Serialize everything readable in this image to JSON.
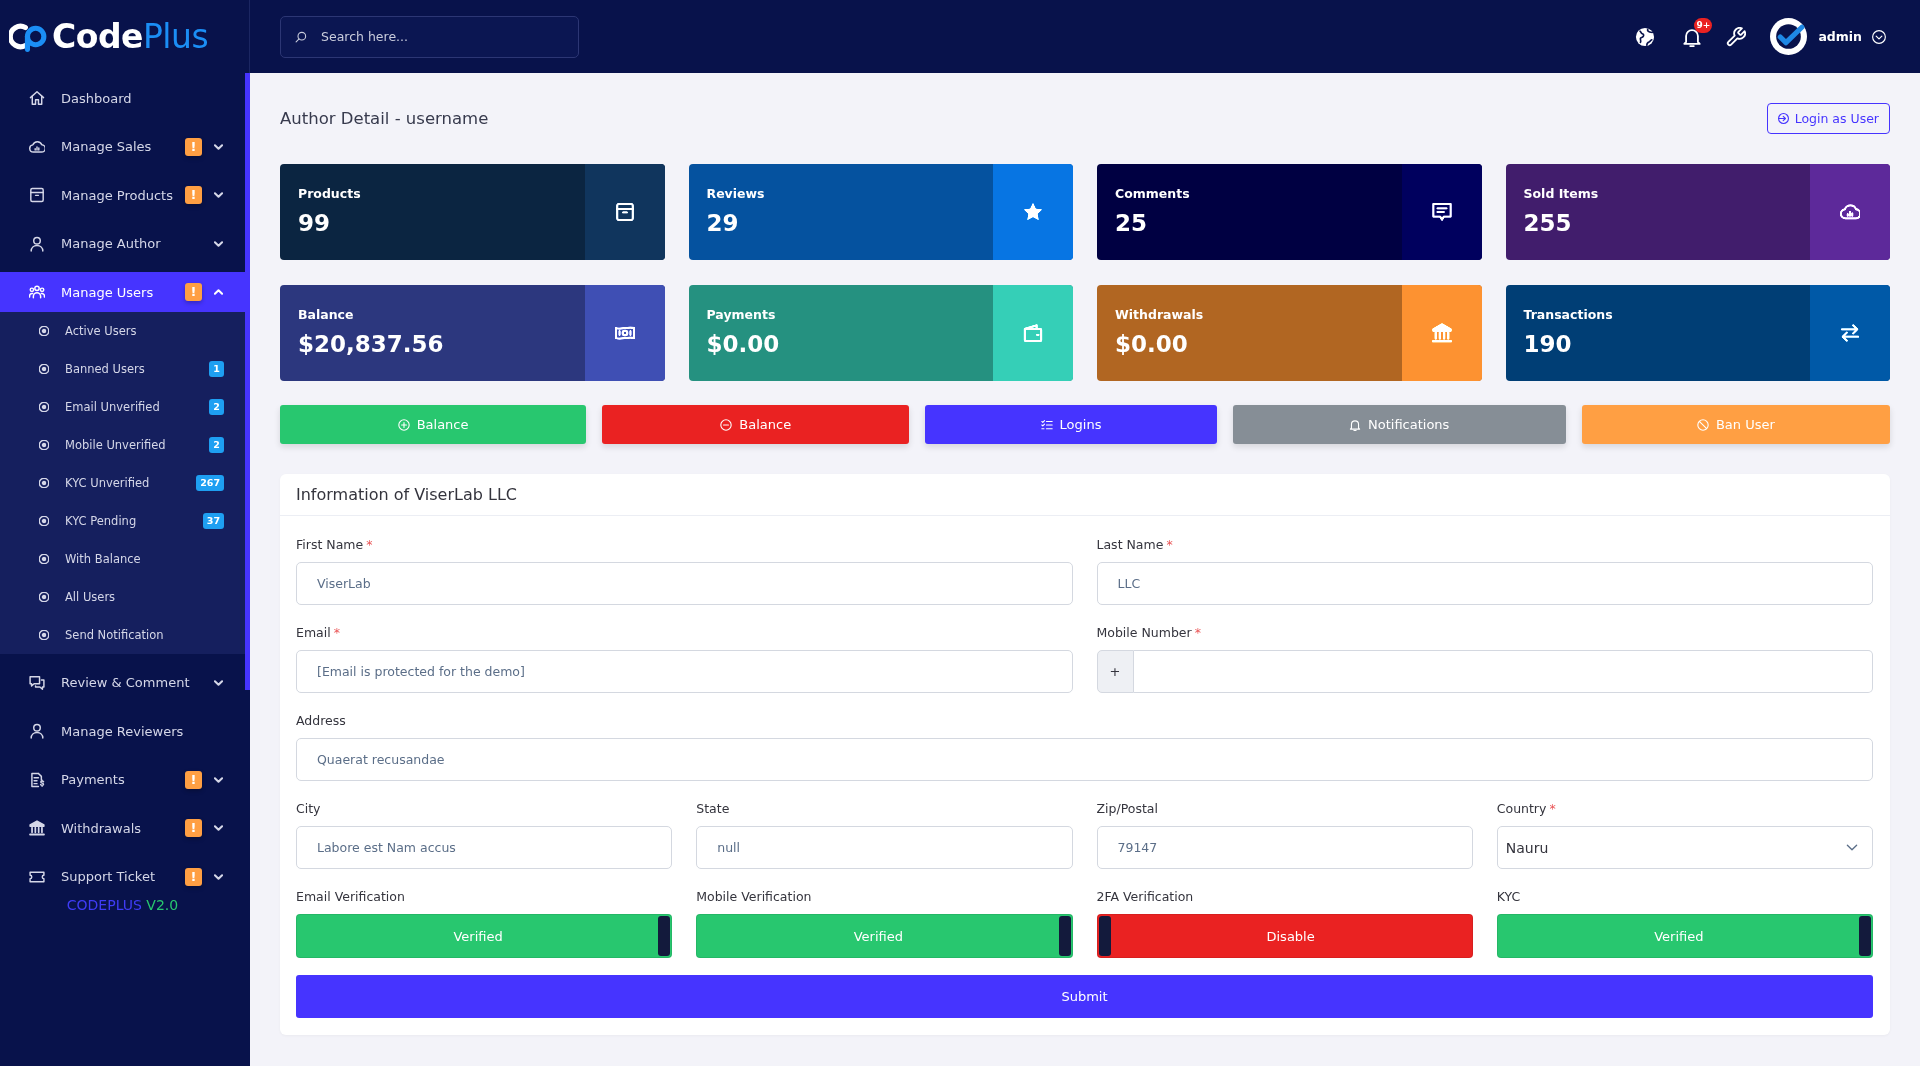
{
  "sidebar": {
    "logo": {
      "text": "Code",
      "accent": "Plus"
    },
    "items": [
      {
        "label": "Dashboard",
        "selected": false
      },
      {
        "label": "Manage Sales",
        "badge": "!",
        "expanded": false,
        "selected": false
      },
      {
        "label": "Manage Products",
        "badge": "!",
        "expanded": false,
        "selected": false
      },
      {
        "label": "Manage Author",
        "expanded": false,
        "selected": false
      },
      {
        "label": "Manage Users",
        "badge": "!",
        "expanded": true,
        "selected": true,
        "children": [
          {
            "label": "Active Users",
            "selected": false
          },
          {
            "label": "Banned Users",
            "badge": "1",
            "selected": false
          },
          {
            "label": "Email Unverified",
            "badge": "2",
            "selected": false
          },
          {
            "label": "Mobile Unverified",
            "badge": "2",
            "selected": false
          },
          {
            "label": "KYC Unverified",
            "badge": "267",
            "selected": false
          },
          {
            "label": "KYC Pending",
            "badge": "37",
            "selected": false
          },
          {
            "label": "With Balance",
            "selected": false
          },
          {
            "label": "All Users",
            "selected": false
          },
          {
            "label": "Send Notification",
            "selected": false
          }
        ]
      },
      {
        "label": "Review & Comment",
        "expanded": false,
        "selected": false
      },
      {
        "label": "Manage Reviewers",
        "selected": false
      },
      {
        "label": "Payments",
        "badge": "!",
        "expanded": false,
        "selected": false
      },
      {
        "label": "Withdrawals",
        "badge": "!",
        "expanded": false,
        "selected": false
      },
      {
        "label": "Support Ticket",
        "badge": "!",
        "expanded": false,
        "selected": false
      }
    ],
    "version": {
      "product": "CODEPLUS",
      "number": "V2.0"
    }
  },
  "topbar": {
    "search": {
      "placeholder": "Search here..."
    },
    "notifications": {
      "count": "9+"
    },
    "user": {
      "name": "admin"
    }
  },
  "page": {
    "title": "Author Detail - username",
    "login_button": "Login as User"
  },
  "stats": [
    {
      "label": "Products",
      "value": "99",
      "color": "#0b2541"
    },
    {
      "label": "Reviews",
      "value": "29",
      "color": "#05529f"
    },
    {
      "label": "Comments",
      "value": "25",
      "color": "#000042"
    },
    {
      "label": "Sold Items",
      "value": "255",
      "color": "#411d6c"
    },
    {
      "label": "Balance",
      "value": "$20,837.56",
      "color": "#2c377e"
    },
    {
      "label": "Payments",
      "value": "$0.00",
      "color": "#259180"
    },
    {
      "label": "Withdrawals",
      "value": "$0.00",
      "color": "#b16622"
    },
    {
      "label": "Transactions",
      "value": "190",
      "color": "#003e75"
    }
  ],
  "actions": [
    {
      "label": "Balance",
      "color": "#28c76f"
    },
    {
      "label": "Balance",
      "color": "#ea2222"
    },
    {
      "label": "Logins",
      "color": "#4634ff"
    },
    {
      "label": "Notifications",
      "color": "#868e96"
    },
    {
      "label": "Ban User",
      "color": "#ff9f43"
    }
  ],
  "info": {
    "title": "Information of ViserLab LLC",
    "rows": [
      [
        {
          "kind": "text",
          "label": "First Name",
          "required_mark": "*",
          "value": "ViserLab"
        },
        {
          "kind": "text",
          "label": "Last Name",
          "required_mark": "*",
          "value": "LLC"
        }
      ],
      [
        {
          "kind": "text",
          "label": "Email",
          "required_mark": "*",
          "value": "[Email is protected for the demo]"
        },
        {
          "kind": "phone",
          "label": "Mobile Number",
          "required_mark": "*",
          "prefix": "+"
        }
      ],
      [
        {
          "kind": "text",
          "label": "Address",
          "value": "Quaerat recusandae"
        }
      ],
      [
        {
          "kind": "text",
          "label": "City",
          "value": "Labore est Nam accus"
        },
        {
          "kind": "text",
          "label": "State",
          "value": "null"
        },
        {
          "kind": "text",
          "label": "Zip/Postal",
          "value": "79147"
        },
        {
          "kind": "select",
          "label": "Country",
          "required_mark": "*",
          "value": "Nauru"
        }
      ]
    ],
    "verifications": [
      {
        "label": "Email Verification",
        "on": true,
        "state_text": "Verified"
      },
      {
        "label": "Mobile Verification",
        "on": true,
        "state_text": "Verified"
      },
      {
        "label": "2FA Verification",
        "on": false,
        "state_text": "Disable"
      },
      {
        "label": "KYC",
        "on": true,
        "state_text": "Verified"
      }
    ],
    "submit": "Submit"
  }
}
